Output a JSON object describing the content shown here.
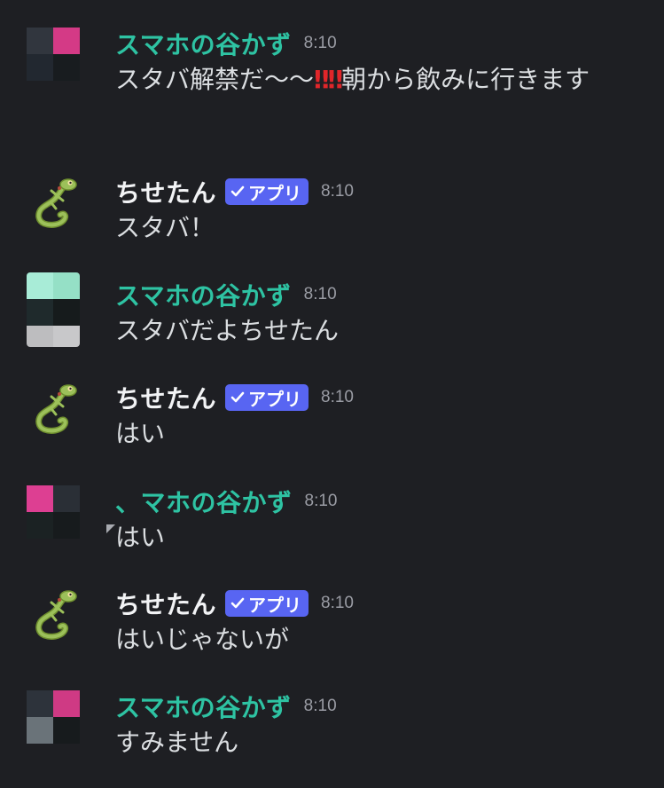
{
  "messages": [
    {
      "author": "スマホの谷かず",
      "time": "8:10",
      "text_before": "スタバ解禁だ〜〜",
      "emphasis": "‼‼",
      "text_after": "朝から飲みに行きます"
    },
    {
      "author": "ちせたん",
      "badge": "アプリ",
      "time": "8:10",
      "text": "スタバ！"
    },
    {
      "author": "スマホの谷かず",
      "time": "8:10",
      "text": "スタバだよちせたん"
    },
    {
      "author": "ちせたん",
      "badge": "アプリ",
      "time": "8:10",
      "text": "はい"
    },
    {
      "author": "、マホの谷かず",
      "time": "8:10",
      "text": "はい"
    },
    {
      "author": "ちせたん",
      "badge": "アプリ",
      "time": "8:10",
      "text": "はいじゃないが"
    },
    {
      "author": "スマホの谷かず",
      "time": "8:10",
      "text": "すみません"
    }
  ],
  "colors": {
    "background": "#1e1f23",
    "user_name": "#2ec3a3",
    "bot_name": "#f2f3f5",
    "badge": "#5865f2",
    "timestamp": "#9a9ca4",
    "message_text": "#dbdee1",
    "emphasis": "#e0262a"
  },
  "icons": {
    "badge_check": "checkmark-icon",
    "bot_avatar": "gecko-avatar-icon"
  }
}
